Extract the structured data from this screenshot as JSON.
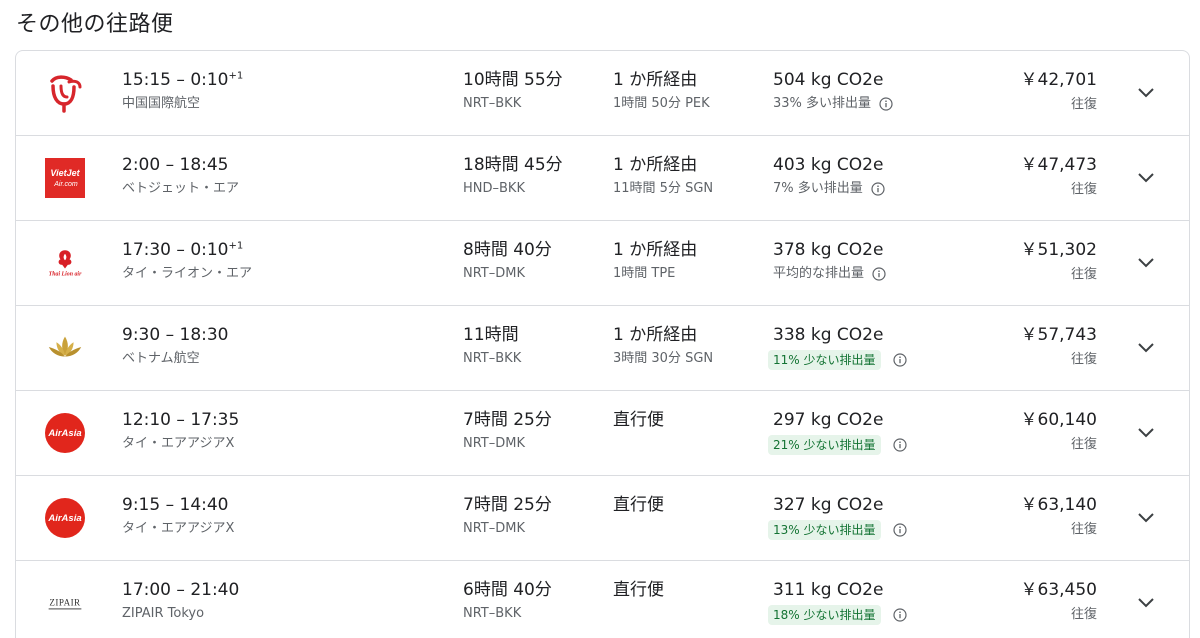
{
  "section_title": "その他の往路便",
  "flights": [
    {
      "logo": "air-china-logo",
      "depart": "15:15",
      "arrive": "0:10",
      "arrive_suffix": "+1",
      "airline": "中国国際航空",
      "duration": "10時間 55分",
      "route": "NRT–BKK",
      "stops": "1 か所経由",
      "layover": "1時間 50分 PEK",
      "co2": "504 kg CO2e",
      "emissions": "33% 多い排出量",
      "emissions_type": "plain",
      "price": "￥42,701",
      "trip": "往復"
    },
    {
      "logo": "vietjet-logo",
      "depart": "2:00",
      "arrive": "18:45",
      "arrive_suffix": "",
      "airline": "ベトジェット・エア",
      "duration": "18時間 45分",
      "route": "HND–BKK",
      "stops": "1 か所経由",
      "layover": "11時間 5分 SGN",
      "co2": "403 kg CO2e",
      "emissions": "7% 多い排出量",
      "emissions_type": "plain",
      "price": "￥47,473",
      "trip": "往復"
    },
    {
      "logo": "thai-lion-air-logo",
      "depart": "17:30",
      "arrive": "0:10",
      "arrive_suffix": "+1",
      "airline": "タイ・ライオン・エア",
      "duration": "8時間 40分",
      "route": "NRT–DMK",
      "stops": "1 か所経由",
      "layover": "1時間 TPE",
      "co2": "378 kg CO2e",
      "emissions": "平均的な排出量",
      "emissions_type": "plain",
      "price": "￥51,302",
      "trip": "往復"
    },
    {
      "logo": "vietnam-airlines-logo",
      "depart": "9:30",
      "arrive": "18:30",
      "arrive_suffix": "",
      "airline": "ベトナム航空",
      "duration": "11時間",
      "route": "NRT–BKK",
      "stops": "1 か所経由",
      "layover": "3時間 30分 SGN",
      "co2": "338 kg CO2e",
      "emissions": "11% 少ない排出量",
      "emissions_type": "badge",
      "price": "￥57,743",
      "trip": "往復"
    },
    {
      "logo": "airasia-logo",
      "depart": "12:10",
      "arrive": "17:35",
      "arrive_suffix": "",
      "airline": "タイ・エアアジアX",
      "duration": "7時間 25分",
      "route": "NRT–DMK",
      "stops": "直行便",
      "layover": "",
      "co2": "297 kg CO2e",
      "emissions": "21% 少ない排出量",
      "emissions_type": "badge",
      "price": "￥60,140",
      "trip": "往復"
    },
    {
      "logo": "airasia-logo",
      "depart": "9:15",
      "arrive": "14:40",
      "arrive_suffix": "",
      "airline": "タイ・エアアジアX",
      "duration": "7時間 25分",
      "route": "NRT–DMK",
      "stops": "直行便",
      "layover": "",
      "co2": "327 kg CO2e",
      "emissions": "13% 少ない排出量",
      "emissions_type": "badge",
      "price": "￥63,140",
      "trip": "往復"
    },
    {
      "logo": "zipair-logo",
      "depart": "17:00",
      "arrive": "21:40",
      "arrive_suffix": "",
      "airline": "ZIPAIR Tokyo",
      "duration": "6時間 40分",
      "route": "NRT–BKK",
      "stops": "直行便",
      "layover": "",
      "co2": "311 kg CO2e",
      "emissions": "18% 少ない排出量",
      "emissions_type": "badge",
      "price": "￥63,450",
      "trip": "往復"
    }
  ],
  "logo_text": {
    "vietjet": "VietJet",
    "vietjet_sub": "Air.com",
    "thai_lion": "Thai Lion air",
    "airasia": "AirAsia",
    "zipair": "ZIPAIR"
  },
  "colors": {
    "text_primary": "#202124",
    "text_secondary": "#5f6368",
    "border": "#dadce0",
    "badge_bg": "#e6f4ea",
    "badge_text": "#137333",
    "air_china_red": "#d7262c",
    "vietjet_red": "#e02a26",
    "airasia_red": "#e1261c",
    "vietnam_gold": "#c9a13a"
  }
}
